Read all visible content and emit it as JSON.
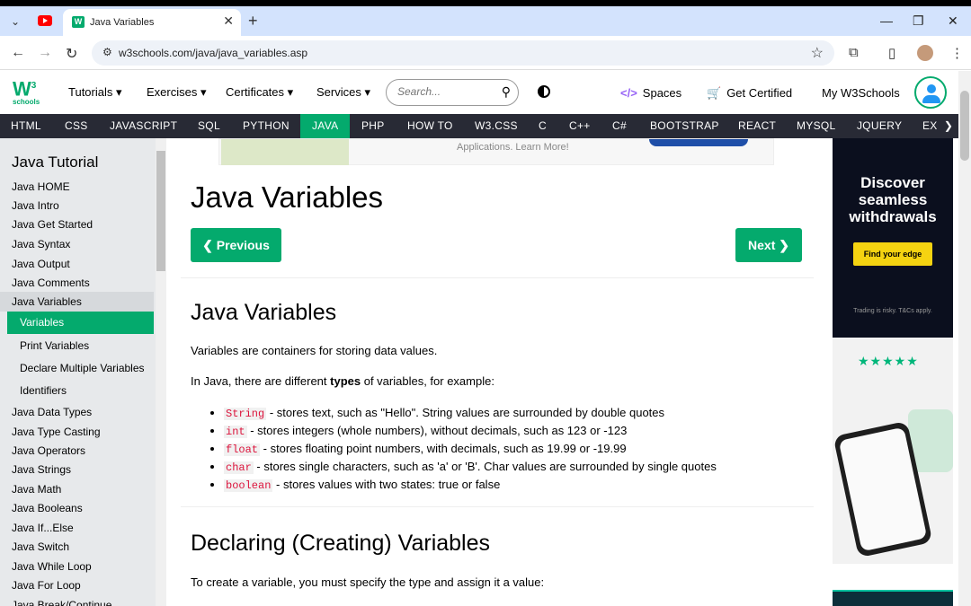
{
  "browser": {
    "tab_title": "Java Variables",
    "url": "w3schools.com/java/java_variables.asp"
  },
  "w3": {
    "logo_main": "W3",
    "logo_sup": "3",
    "logo_sub": "schools",
    "menu": [
      "Tutorials",
      "Exercises",
      "Certificates",
      "Services"
    ],
    "search_placeholder": "Search...",
    "spaces": "Spaces",
    "get_certified": "Get Certified",
    "my_w3": "My W3Schools"
  },
  "topnav": [
    "HTML",
    "CSS",
    "JAVASCRIPT",
    "SQL",
    "PYTHON",
    "JAVA",
    "PHP",
    "HOW TO",
    "W3.CSS",
    "C",
    "C++",
    "C#",
    "BOOTSTRAP",
    "REACT",
    "MYSQL",
    "JQUERY",
    "EX"
  ],
  "sidebar": {
    "title": "Java Tutorial",
    "items": [
      "Java HOME",
      "Java Intro",
      "Java Get Started",
      "Java Syntax",
      "Java Output",
      "Java Comments",
      "Java Variables"
    ],
    "subitems": [
      "Variables",
      "Print Variables",
      "Declare Multiple Variables",
      "Identifiers"
    ],
    "items2": [
      "Java Data Types",
      "Java Type Casting",
      "Java Operators",
      "Java Strings",
      "Java Math",
      "Java Booleans",
      "Java If...Else",
      "Java Switch",
      "Java While Loop",
      "Java For Loop",
      "Java Break/Continue"
    ]
  },
  "ad_top": {
    "text": "Applications. Learn More!"
  },
  "main": {
    "h1": "Java Variables",
    "prev": "❮ Previous",
    "next": "Next ❯",
    "h2": "Java Variables",
    "p1": "Variables are containers for storing data values.",
    "p2_pre": "In Java, there are different ",
    "p2_bold": "types",
    "p2_post": " of variables, for example:",
    "list": [
      {
        "code": "String",
        "text": " - stores text, such as \"Hello\". String values are surrounded by double quotes"
      },
      {
        "code": "int",
        "text": " - stores integers (whole numbers), without decimals, such as 123 or -123"
      },
      {
        "code": "float",
        "text": " - stores floating point numbers, with decimals, such as 19.99 or -19.99"
      },
      {
        "code": "char",
        "text": " - stores single characters, such as 'a' or 'B'. Char values are surrounded by single quotes"
      },
      {
        "code": "boolean",
        "text": " - stores values with two states: true or false"
      }
    ],
    "h2b": "Declaring (Creating) Variables",
    "p3": "To create a variable, you must specify the type and assign it a value:"
  },
  "right_ad": {
    "headline": "Discover seamless withdrawals",
    "button": "Find your edge",
    "small": "Trading is risky. T&Cs apply."
  }
}
